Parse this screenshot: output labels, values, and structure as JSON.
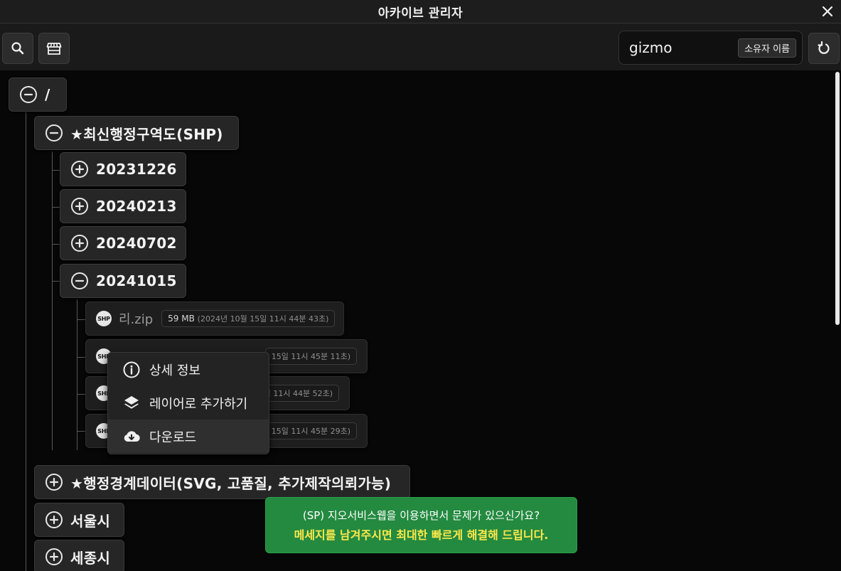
{
  "window": {
    "title": "아카이브 관리자"
  },
  "toolbar": {
    "owner_value": "gizmo",
    "owner_label": "소유자 이름"
  },
  "tree": {
    "root": "/",
    "level1": [
      {
        "label": "★최신행정구역도(SHP)",
        "expanded": true
      },
      {
        "label": "★행정경계데이터(SVG, 고품질, 추가제작의뢰가능)",
        "expanded": false
      },
      {
        "label": "서울시",
        "expanded": false
      },
      {
        "label": "세종시",
        "expanded": false
      }
    ],
    "dates": [
      "20231226",
      "20240213",
      "20240702",
      "20241015"
    ],
    "files": [
      {
        "badge": "SHP",
        "name": "리.zip",
        "size": "59 MB",
        "date": "(2024년 10월 15일 11시 44분 43초)"
      },
      {
        "badge": "SHP",
        "info_partial": "15일 11시 45분 11초)"
      },
      {
        "badge": "SHP",
        "info_partial": "일 11시 44분 52초)"
      },
      {
        "badge": "SHP",
        "info_partial": "15일 11시 45분 29초)"
      }
    ]
  },
  "context_menu": {
    "items": [
      {
        "label": "상세 정보",
        "icon": "info-icon"
      },
      {
        "label": "레이어로 추가하기",
        "icon": "layers-icon"
      },
      {
        "label": "다운로드",
        "icon": "cloud-download-icon"
      }
    ]
  },
  "toast": {
    "line1": "(SP) 지오서비스웹을 이용하면서 문제가 있으신가요?",
    "line2": "메세지를 남겨주시면 최대한 빠르게 해결해 드립니다."
  }
}
